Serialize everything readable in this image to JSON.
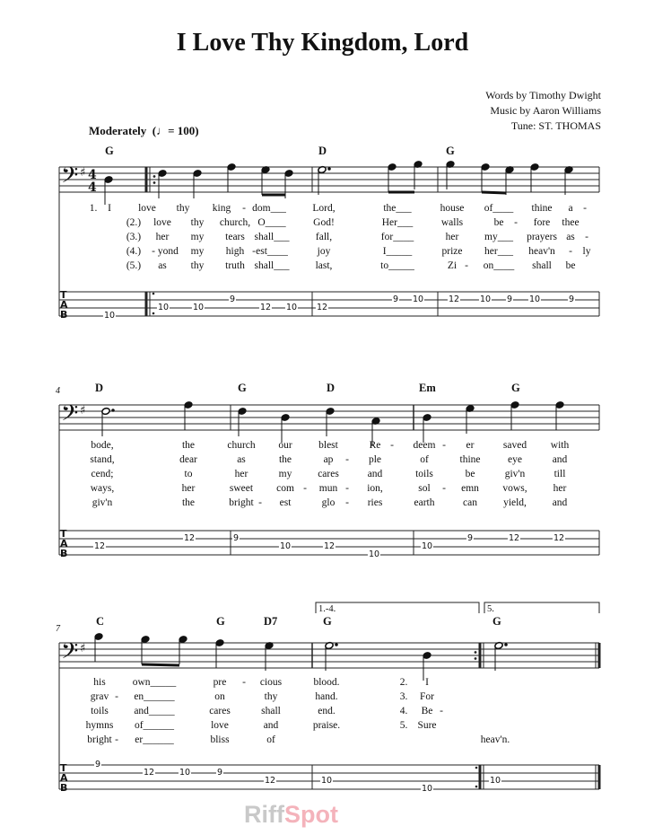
{
  "title": "I Love Thy Kingdom, Lord",
  "credits": [
    "Words by Timothy Dwight",
    "Music by Aaron Williams",
    "Tune: ST. THOMAS"
  ],
  "tempo": {
    "label": "Moderately",
    "marking": "(♩= 100)"
  },
  "time_signature": "4/4",
  "key_signature": "G major (1 sharp)",
  "clef": "bass",
  "systems": [
    {
      "measure_number": "",
      "chords": [
        "G",
        "D",
        "G"
      ],
      "lyrics": [
        [
          "1.",
          "I",
          "love",
          "thy",
          "king",
          "-",
          "dom___",
          "Lord,",
          "the___",
          "house",
          "of____",
          "thine",
          "a",
          "-"
        ],
        [
          "(2.)",
          "love",
          "thy",
          "church,",
          "O____",
          "God!",
          "Her___",
          "walls",
          "be",
          "-",
          "fore",
          "thee"
        ],
        [
          "(3.)",
          "her",
          "my",
          "tears",
          "shall___",
          "fall,",
          "for____",
          "her",
          "my___",
          "prayers",
          "as",
          "-"
        ],
        [
          "(4.)",
          "- yond",
          "my",
          "high",
          "-",
          "est____",
          "joy",
          "I_____",
          "prize",
          "her___",
          "heav'n",
          "-",
          "ly"
        ],
        [
          "(5.)",
          "as",
          "thy",
          "truth",
          "shall___",
          "last,",
          "to_____",
          "Zi",
          "-",
          "on____",
          "shall",
          "be"
        ]
      ],
      "tab": [
        "10",
        "10",
        "10",
        "9",
        "12",
        "10",
        "12",
        "9",
        "10",
        "12",
        "10",
        "9",
        "10",
        "9"
      ]
    },
    {
      "measure_number": "4",
      "chords": [
        "D",
        "G",
        "D",
        "Em",
        "G"
      ],
      "lyrics": [
        [
          "bode,",
          "the",
          "church",
          "our",
          "blest",
          "Re",
          "-",
          "deem",
          "-",
          "er",
          "saved",
          "with"
        ],
        [
          "stand,",
          "dear",
          "as",
          "the",
          "ap",
          "-",
          "ple",
          "of",
          "thine",
          "eye",
          "and"
        ],
        [
          "cend;",
          "to",
          "her",
          "my",
          "cares",
          "and",
          "toils",
          "be",
          "giv'n",
          "till"
        ],
        [
          "ways,",
          "her",
          "sweet",
          "com",
          "-",
          "mun",
          "-",
          "ion,",
          "sol",
          "-",
          "emn",
          "vows,",
          "her"
        ],
        [
          "giv'n",
          "the",
          "bright",
          "-",
          "est",
          "glo",
          "-",
          "ries",
          "earth",
          "can",
          "yield,",
          "and"
        ]
      ],
      "tab": [
        "12",
        "12",
        "9",
        "10",
        "12",
        "10",
        "10",
        "9",
        "12",
        "12"
      ]
    },
    {
      "measure_number": "7",
      "chords": [
        "C",
        "G",
        "D7",
        "G",
        "G"
      ],
      "voltas": [
        "1.-4.",
        "5."
      ],
      "lyrics": [
        [
          "his",
          "own_____",
          "pre",
          "-",
          "cious",
          "blood.",
          "2.",
          "I"
        ],
        [
          "grav",
          "-",
          "en______",
          "on",
          "thy",
          "hand.",
          "3.",
          "For"
        ],
        [
          "toils",
          "and_____",
          "cares",
          "shall",
          "end.",
          "4.",
          "Be",
          "-"
        ],
        [
          "hymns",
          "of______",
          "love",
          "and",
          "praise.",
          "5.",
          "Sure"
        ],
        [
          "bright",
          "-",
          "er______",
          "bliss",
          "of",
          "heav'n."
        ]
      ],
      "tab": [
        "9",
        "12",
        "10",
        "9",
        "12",
        "10",
        "10",
        "10"
      ]
    }
  ],
  "watermark": {
    "part1": "Riff",
    "part2": "Spot"
  }
}
